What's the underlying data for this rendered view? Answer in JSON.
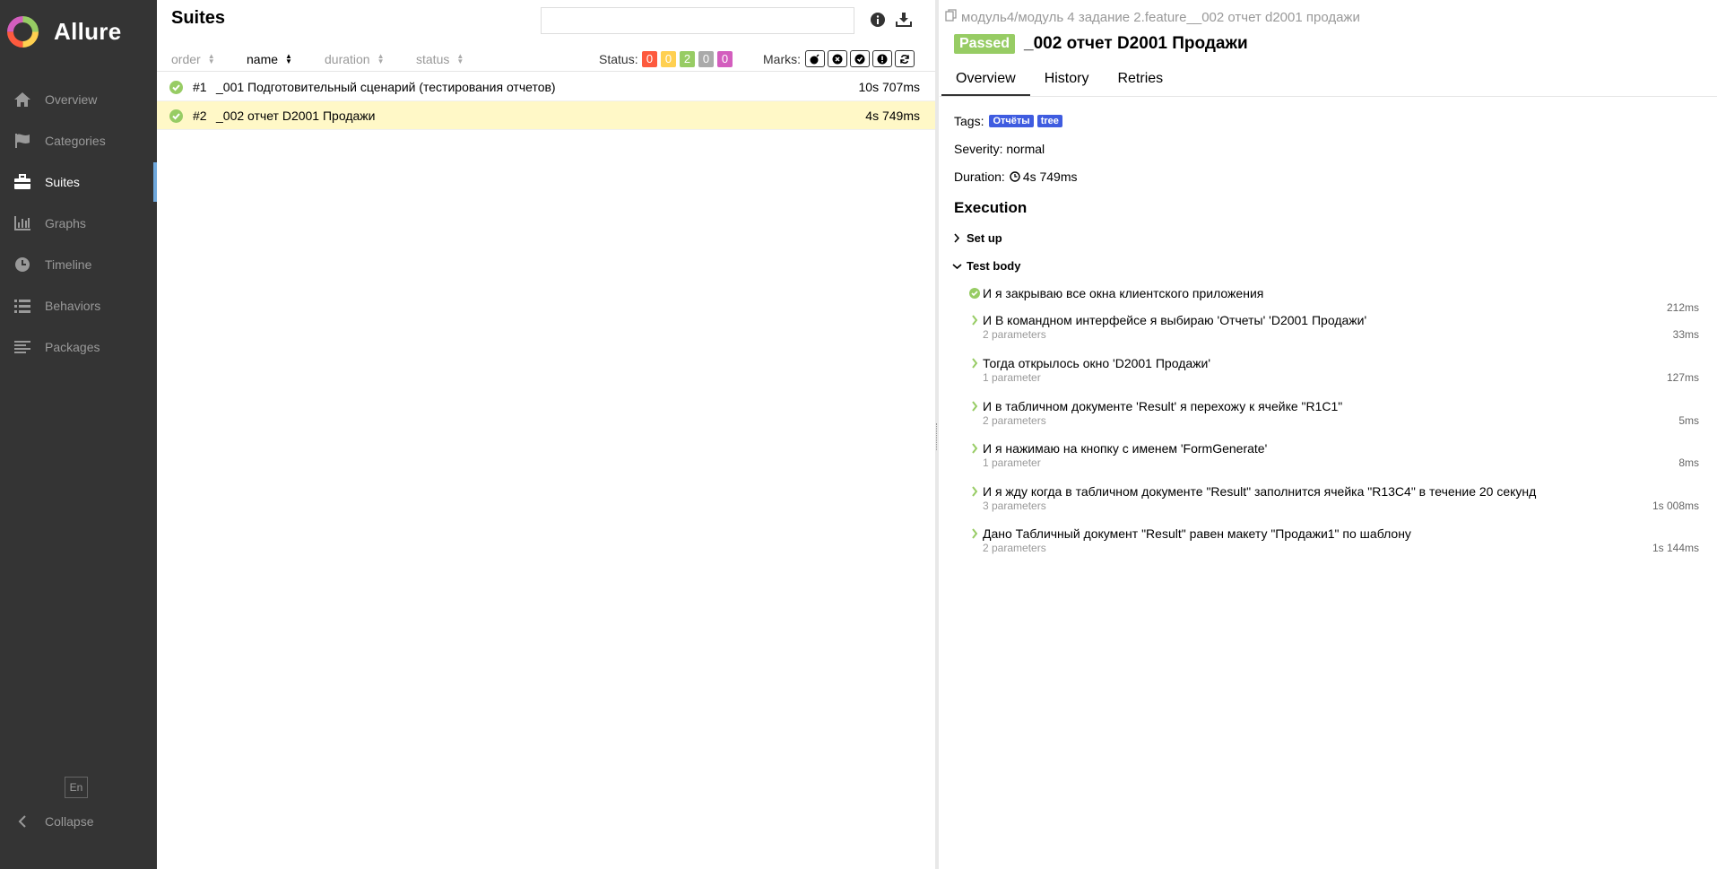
{
  "app": {
    "title": "Allure"
  },
  "sidebar": {
    "items": [
      {
        "label": "Overview",
        "icon": "home-icon"
      },
      {
        "label": "Categories",
        "icon": "flag-icon"
      },
      {
        "label": "Suites",
        "icon": "briefcase-icon",
        "active": true
      },
      {
        "label": "Graphs",
        "icon": "bar-chart-icon"
      },
      {
        "label": "Timeline",
        "icon": "clock-icon"
      },
      {
        "label": "Behaviors",
        "icon": "list-icon"
      },
      {
        "label": "Packages",
        "icon": "align-left-icon"
      }
    ],
    "language": "En",
    "collapse_label": "Collapse"
  },
  "suites": {
    "title": "Suites",
    "search_placeholder": "",
    "columns": {
      "order": "order",
      "name": "name",
      "duration": "duration",
      "status": "status"
    },
    "status_label": "Status:",
    "status_counts": [
      {
        "value": "0",
        "color": "#fd5a3e"
      },
      {
        "value": "0",
        "color": "#ffd050"
      },
      {
        "value": "2",
        "color": "#97cc64"
      },
      {
        "value": "0",
        "color": "#aaaaaa"
      },
      {
        "value": "0",
        "color": "#d35ebe"
      }
    ],
    "marks_label": "Marks:",
    "rows": [
      {
        "num": "#1",
        "name": "_001 Подготовительный сценарий (тестирования отчетов)",
        "duration": "10s 707ms",
        "selected": false
      },
      {
        "num": "#2",
        "name": "_002 отчет D2001 Продажи",
        "duration": "4s 749ms",
        "selected": true
      }
    ]
  },
  "detail": {
    "breadcrumb": "модуль4/модуль 4 задание 2.feature__002 отчет d2001 продажи",
    "status": "Passed",
    "title": "_002 отчет D2001 Продажи",
    "tabs": [
      "Overview",
      "History",
      "Retries"
    ],
    "tags_label": "Tags:",
    "tags": [
      "Отчёты",
      "tree"
    ],
    "severity": "Severity: normal",
    "duration_label": "Duration:",
    "duration": "4s 749ms",
    "execution_title": "Execution",
    "setup_label": "Set up",
    "body_label": "Test body",
    "steps": [
      {
        "title": "И я закрываю все окна клиентского приложения",
        "params": "",
        "duration": "212ms",
        "expandable": false
      },
      {
        "title": "И В командном интерфейсе я выбираю 'Отчеты' 'D2001 Продажи'",
        "params": "2 parameters",
        "duration": "33ms",
        "expandable": true
      },
      {
        "title": "Тогда открылось окно 'D2001 Продажи'",
        "params": "1 parameter",
        "duration": "127ms",
        "expandable": true
      },
      {
        "title": "И в табличном документе 'Result' я перехожу к ячейке \"R1C1\"",
        "params": "2 parameters",
        "duration": "5ms",
        "expandable": true
      },
      {
        "title": "И я нажимаю на кнопку с именем 'FormGenerate'",
        "params": "1 parameter",
        "duration": "8ms",
        "expandable": true
      },
      {
        "title": "И я жду когда в табличном документе \"Result\" заполнится ячейка \"R13C4\" в течение 20 секунд",
        "params": "3 parameters",
        "duration": "1s 008ms",
        "expandable": true
      },
      {
        "title": "Дано Табличный документ \"Result\" равен макету \"Продажи1\" по шаблону",
        "params": "2 parameters",
        "duration": "1s 144ms",
        "expandable": true
      }
    ]
  }
}
